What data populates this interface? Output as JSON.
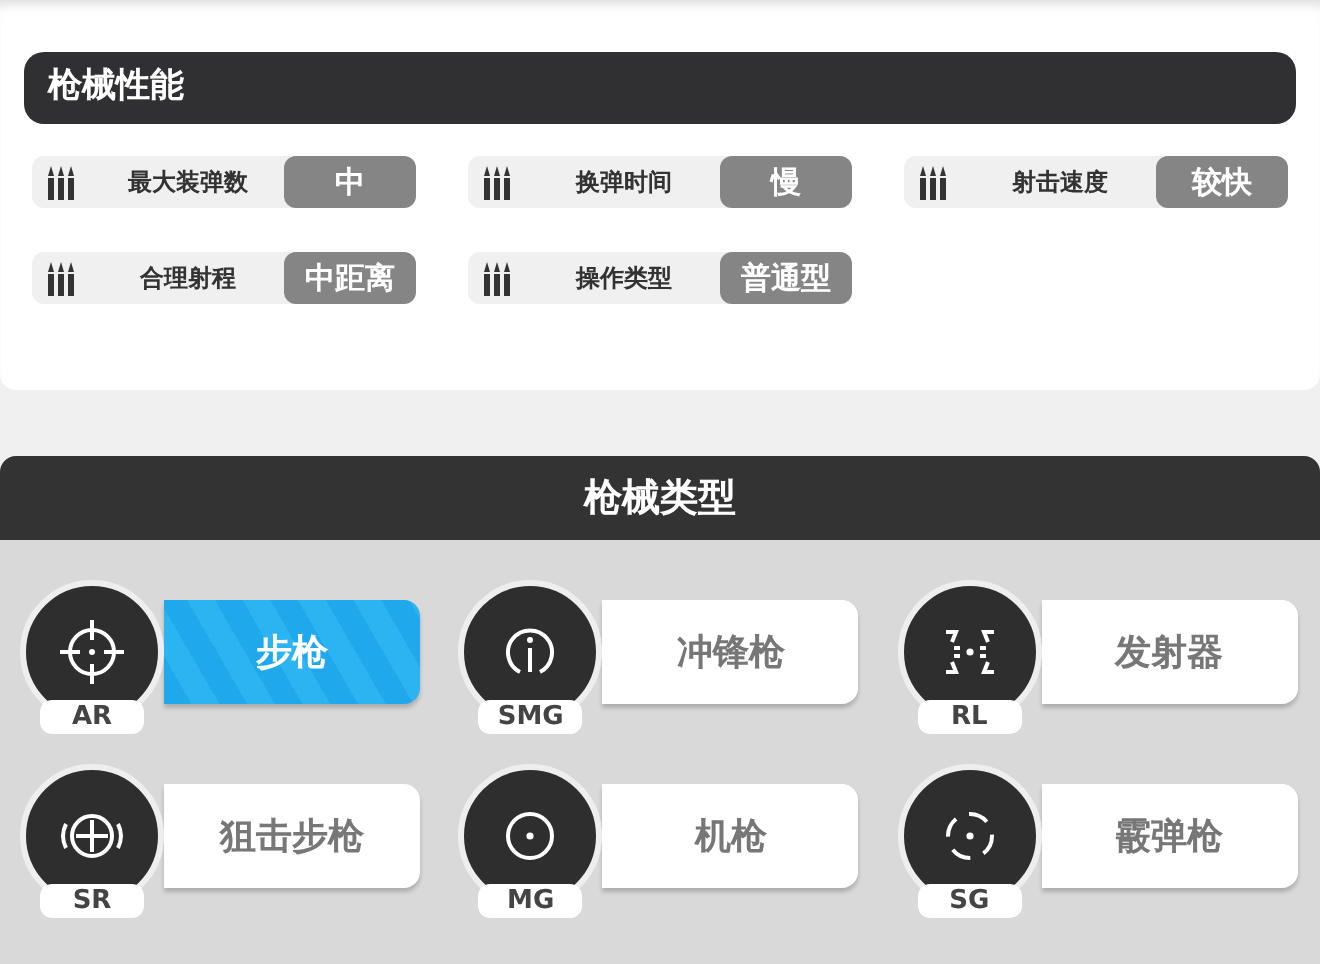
{
  "performance": {
    "title": "枪械性能",
    "stats": [
      {
        "label": "最大装弹数",
        "value": "中"
      },
      {
        "label": "换弹时间",
        "value": "慢"
      },
      {
        "label": "射击速度",
        "value": "较快"
      },
      {
        "label": "合理射程",
        "value": "中距离"
      },
      {
        "label": "操作类型",
        "value": "普通型"
      }
    ]
  },
  "types": {
    "title": "枪械类型",
    "items": [
      {
        "code": "AR",
        "name": "步枪",
        "selected": true
      },
      {
        "code": "SMG",
        "name": "冲锋枪",
        "selected": false
      },
      {
        "code": "RL",
        "name": "发射器",
        "selected": false
      },
      {
        "code": "SR",
        "name": "狙击步枪",
        "selected": false
      },
      {
        "code": "MG",
        "name": "机枪",
        "selected": false
      },
      {
        "code": "SG",
        "name": "霰弹枪",
        "selected": false
      }
    ]
  }
}
